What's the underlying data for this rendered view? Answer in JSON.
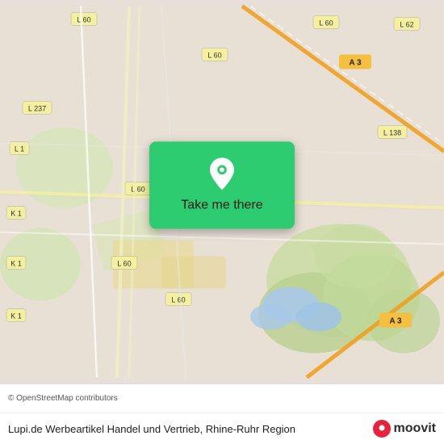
{
  "map": {
    "attribution": "© OpenStreetMap contributors"
  },
  "card": {
    "button_label": "Take me there"
  },
  "footer": {
    "location_name": "Lupi.de Werbeartikel Handel und Vertrieb, Rhine-Ruhr Region",
    "moovit_label": "moovit"
  }
}
